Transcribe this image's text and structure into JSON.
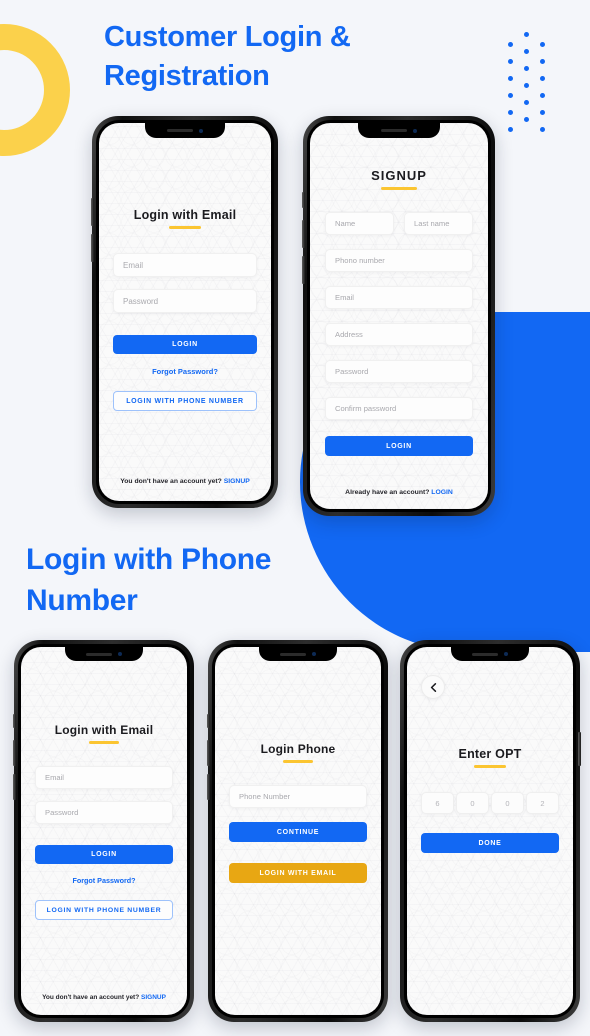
{
  "colors": {
    "page_bg": "#f4f6fa",
    "accent_blue": "#1268F3",
    "accent_yellow": "#FBD14B",
    "button_yellow": "#E8A713",
    "screen_bg": "#fafafa"
  },
  "headings": {
    "top": "Customer Login & Registration",
    "middle": "Login with Phone Number"
  },
  "screens": {
    "login_email_1": {
      "title": "Login with Email",
      "fields": [
        {
          "placeholder": "Email"
        },
        {
          "placeholder": "Password"
        }
      ],
      "primary_button": "LOGIN",
      "forgot_link": "Forgot Password?",
      "outline_button": "LOGIN WITH PHONE NUMBER",
      "footer_text": "You don't have an account yet?",
      "footer_link": "SIGNUP"
    },
    "signup": {
      "title": "SIGNUP",
      "fields_row": [
        {
          "placeholder": "Name"
        },
        {
          "placeholder": "Last name"
        }
      ],
      "fields": [
        {
          "placeholder": "Phono number"
        },
        {
          "placeholder": "Email"
        },
        {
          "placeholder": "Address"
        },
        {
          "placeholder": "Password"
        },
        {
          "placeholder": "Confirm password"
        }
      ],
      "primary_button": "LOGIN",
      "footer_text": "Already have an account?",
      "footer_link": "LOGIN"
    },
    "login_email_2": {
      "title": "Login with Email",
      "fields": [
        {
          "placeholder": "Email"
        },
        {
          "placeholder": "Password"
        }
      ],
      "primary_button": "LOGIN",
      "forgot_link": "Forgot Password?",
      "outline_button": "LOGIN WITH PHONE NUMBER",
      "footer_text": "You don't have an account yet?",
      "footer_link": "SIGNUP"
    },
    "login_phone": {
      "title": "Login Phone",
      "fields": [
        {
          "placeholder": "Phone Number"
        }
      ],
      "primary_button": "CONTINUE",
      "secondary_button": "LOGIN WITH EMAIL"
    },
    "enter_otp": {
      "back_icon": "chevron-left-icon",
      "title": "Enter OPT",
      "otp_digits": [
        "6",
        "0",
        "0",
        "2"
      ],
      "primary_button": "DONE"
    }
  }
}
